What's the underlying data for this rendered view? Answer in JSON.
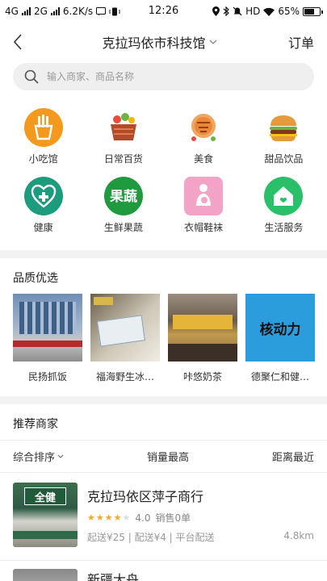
{
  "status": {
    "left_text": "4G",
    "left_text2": "2G",
    "speed": "6.2K/s",
    "time": "12:26",
    "hd": "HD",
    "battery": "65%",
    "battery_level": 0.65
  },
  "header": {
    "title": "克拉玛依市科技馆",
    "order_label": "订单"
  },
  "search": {
    "placeholder": "输入商家、商品名称"
  },
  "categories": [
    {
      "label": "小吃馆",
      "icon": "fries-icon"
    },
    {
      "label": "日常百货",
      "icon": "basket-icon"
    },
    {
      "label": "美食",
      "icon": "food-icon"
    },
    {
      "label": "甜品饮品",
      "icon": "burger-icon"
    },
    {
      "label": "健康",
      "icon": "health-icon"
    },
    {
      "label": "生鲜果蔬",
      "icon": "vegetables-icon"
    },
    {
      "label": "衣帽鞋袜",
      "icon": "mother-baby-icon"
    },
    {
      "label": "生活服务",
      "icon": "home-icon"
    }
  ],
  "quality": {
    "title": "品质优选",
    "items": [
      {
        "label": "民扬抓饭"
      },
      {
        "label": "福海野生冰…"
      },
      {
        "label": "咔悠奶茶"
      },
      {
        "label": "德聚仁和健…",
        "logo_text": "核动力"
      }
    ]
  },
  "recommend": {
    "title": "推荐商家",
    "sort_tabs": [
      "综合排序",
      "销量最高",
      "距离最近"
    ]
  },
  "merchants": [
    {
      "name": "克拉玛依区萍子商行",
      "rating": 4.0,
      "rating_text": "4.0",
      "sales": "销售0单",
      "meta": "起送¥25 | 配送¥4 | 平台配送",
      "distance": "4.8km",
      "img_text": "全健"
    },
    {
      "name": "新疆大舟"
    }
  ]
}
